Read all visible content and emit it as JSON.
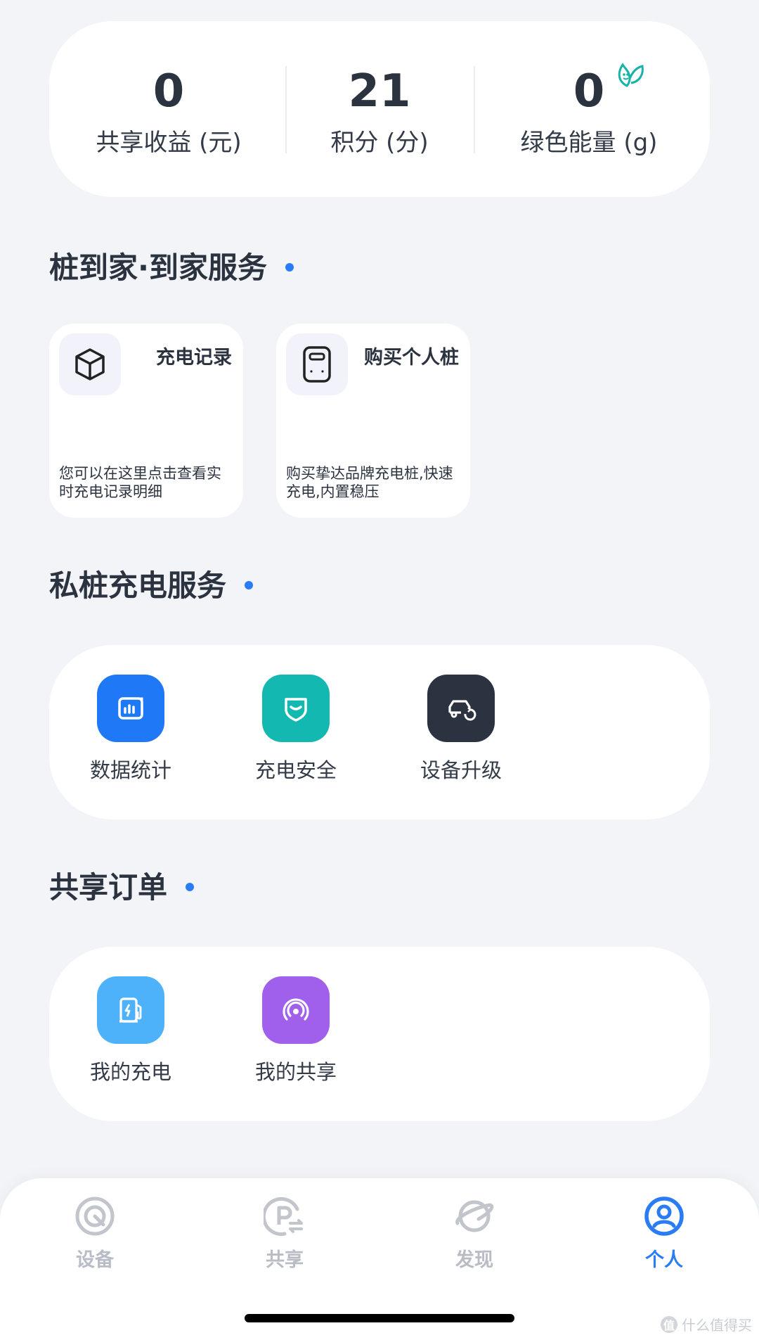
{
  "stats": [
    {
      "value": "0",
      "label": "共享收益 (元)"
    },
    {
      "value": "21",
      "label": "积分 (分)"
    },
    {
      "value": "0",
      "label": "绿色能量 (g)"
    }
  ],
  "home_service": {
    "title": "桩到家·到家服务",
    "tiles": [
      {
        "title": "充电记录",
        "desc": "您可以在这里点击查看实时充电记录明细",
        "icon": "cube-icon"
      },
      {
        "title": "购买个人桩",
        "desc": "购买挚达品牌充电桩,快速充电,内置稳压",
        "icon": "charger-icon"
      }
    ]
  },
  "private_service": {
    "title": "私桩充电服务",
    "items": [
      {
        "label": "数据统计",
        "icon": "chart-icon",
        "color": "#1f78f5"
      },
      {
        "label": "充电安全",
        "icon": "shield-icon",
        "color": "#13b8b0"
      },
      {
        "label": "设备升级",
        "icon": "car-refresh-icon",
        "color": "#2c3340"
      }
    ]
  },
  "shared_orders": {
    "title": "共享订单",
    "items": [
      {
        "label": "我的充电",
        "icon": "fuel-station-icon",
        "color": "#4eb2fb"
      },
      {
        "label": "我的共享",
        "icon": "broadcast-icon",
        "color": "#a060ec"
      }
    ]
  },
  "tabbar": {
    "tabs": [
      {
        "label": "设备",
        "icon": "device-icon",
        "active": false
      },
      {
        "label": "共享",
        "icon": "parking-share-icon",
        "active": false
      },
      {
        "label": "发现",
        "icon": "planet-icon",
        "active": false
      },
      {
        "label": "个人",
        "icon": "user-icon",
        "active": true
      }
    ]
  },
  "watermark": {
    "badge": "值",
    "text": "什么值得买"
  },
  "colors": {
    "accent": "#2a7cf6",
    "background": "#f3f4f8"
  }
}
